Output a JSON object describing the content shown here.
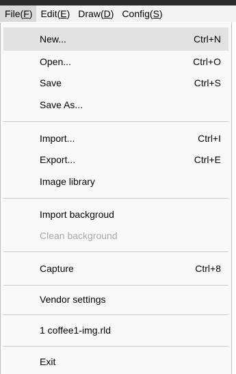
{
  "menubar": {
    "items": [
      {
        "pre": "File(",
        "key": "F",
        "post": ")"
      },
      {
        "pre": "Edit(",
        "key": "E",
        "post": ")"
      },
      {
        "pre": "Draw(",
        "key": "D",
        "post": ")"
      },
      {
        "pre": "Config(",
        "key": "S",
        "post": ")"
      }
    ]
  },
  "file_menu": {
    "new": {
      "label": "New...",
      "shortcut": "Ctrl+N"
    },
    "open": {
      "label": "Open...",
      "shortcut": "Ctrl+O"
    },
    "save": {
      "label": "Save",
      "shortcut": "Ctrl+S"
    },
    "save_as": {
      "label": "Save As..."
    },
    "import": {
      "label": "Import...",
      "shortcut": "Ctrl+I"
    },
    "export": {
      "label": "Export...",
      "shortcut": "Ctrl+E"
    },
    "image_library": {
      "label": "Image library"
    },
    "import_background": {
      "label": "Import backgroud"
    },
    "clean_background": {
      "label": "Clean background",
      "disabled": true
    },
    "capture": {
      "label": "Capture",
      "shortcut": "Ctrl+8"
    },
    "vendor_settings": {
      "label": "Vendor settings"
    },
    "recent_1": {
      "label": "1 coffee1-img.rld"
    },
    "exit": {
      "label": "Exit"
    }
  },
  "colors": {
    "menubar_bg": "#f3f3f3",
    "menu_bg": "#f9f9f9",
    "highlight": "#e2e2e2",
    "disabled_text": "#a8a8a8",
    "separator": "#c9c9c9"
  }
}
